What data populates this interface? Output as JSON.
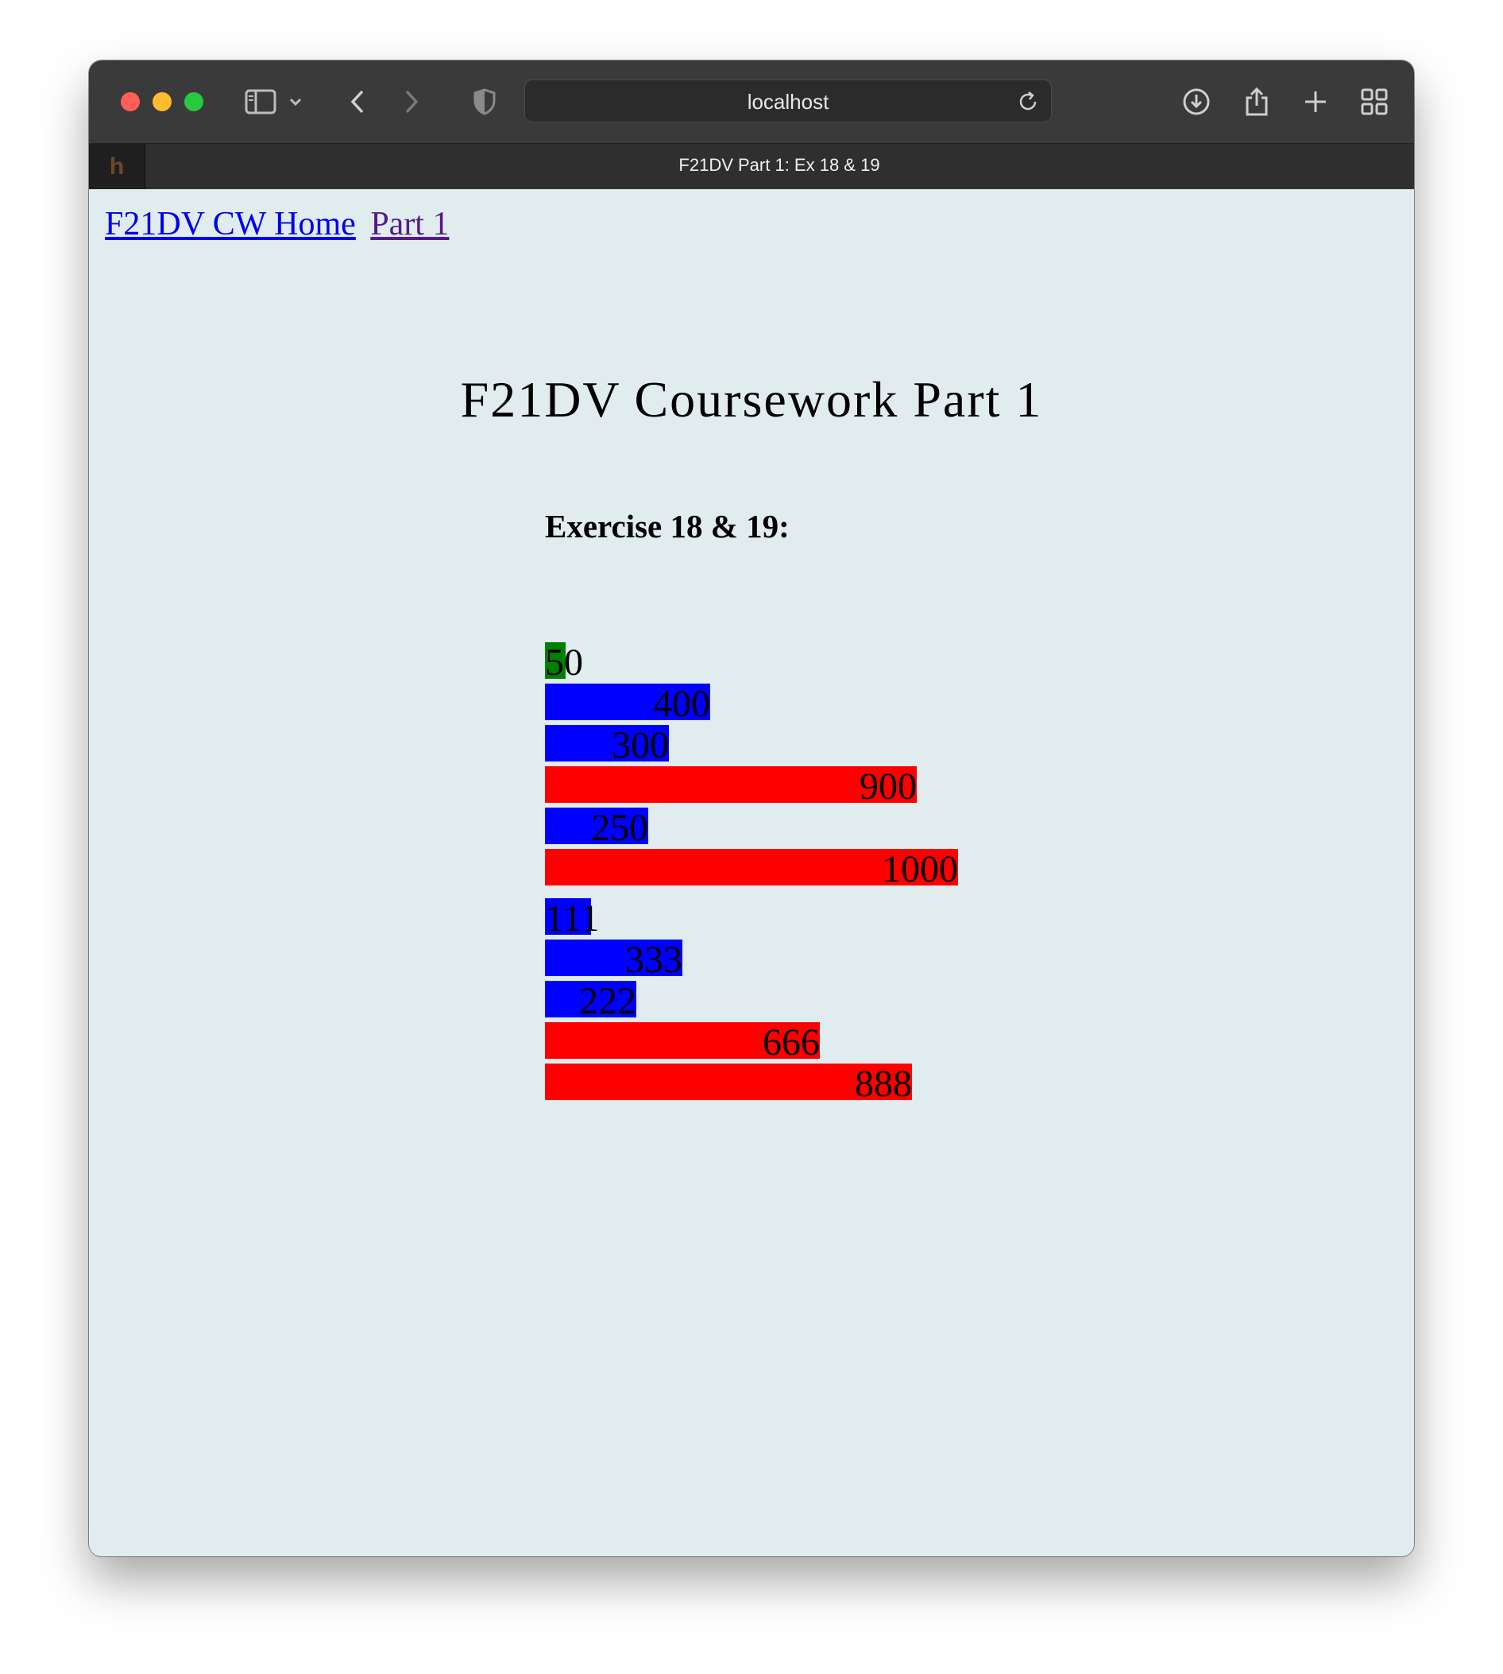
{
  "browser": {
    "address": "localhost",
    "tab_title": "F21DV Part 1: Ex 18 & 19",
    "favicon_letter": "h"
  },
  "nav": {
    "home_link": "F21DV CW Home",
    "part1_link": "Part 1"
  },
  "page_title": "F21DV Coursework Part 1",
  "exercise_heading": "Exercise 18 & 19:",
  "colors": {
    "green": "#008000",
    "blue": "#0000ff",
    "red": "#ff0000",
    "background": "#e1ecee"
  },
  "chart_data": {
    "type": "bar",
    "orientation": "horizontal",
    "groups": [
      {
        "values": [
          50,
          400,
          300,
          900,
          250,
          1000
        ],
        "labels": [
          "50",
          "400",
          "300",
          "900",
          "250",
          "1000"
        ],
        "colors": [
          "green",
          "blue",
          "blue",
          "red",
          "blue",
          "red"
        ]
      },
      {
        "values": [
          111,
          333,
          222,
          666,
          888
        ],
        "labels": [
          "111",
          "333",
          "222",
          "666",
          "888"
        ],
        "colors": [
          "blue",
          "blue",
          "blue",
          "red",
          "red"
        ]
      }
    ]
  }
}
